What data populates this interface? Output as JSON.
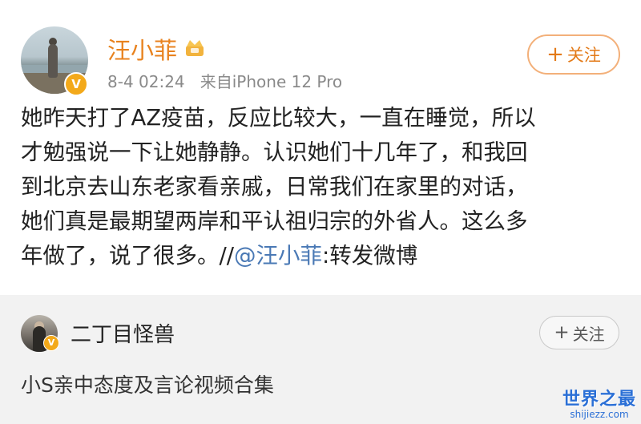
{
  "post": {
    "username": "汪小菲",
    "verified_icon": "v-badge-icon",
    "user_icon": "crown-icon",
    "time": "8-4 02:24",
    "source": "来自iPhone 12 Pro",
    "follow_plus": "+",
    "follow_label": "关注",
    "content_lines": [
      "她昨天打了AZ疫苗，反应比较大，一直在睡觉，所以",
      "才勉强说一下让她静静。认识她们十几年了，和我回",
      "到北京去山东老家看亲戚，日常我们在家里的对话，",
      "她们真是最期望两岸和平认祖归宗的外省人。这么多"
    ],
    "last_line_prefix": "年做了，说了很多。//",
    "mention": "@汪小菲",
    "last_line_suffix": ":转发微博"
  },
  "repost": {
    "username": "二丁目怪兽",
    "verified_icon": "v-badge-icon",
    "follow_plus": "+",
    "follow_label": "关注",
    "text": "小S亲中态度及言论视频合集"
  },
  "watermark": {
    "title": "世界之最",
    "domain": "shijiezz.com"
  },
  "colors": {
    "username": "#e8821e",
    "mention": "#4a79b5",
    "follow_border": "#f3b07a",
    "repost_bg": "#f2f2f2"
  }
}
